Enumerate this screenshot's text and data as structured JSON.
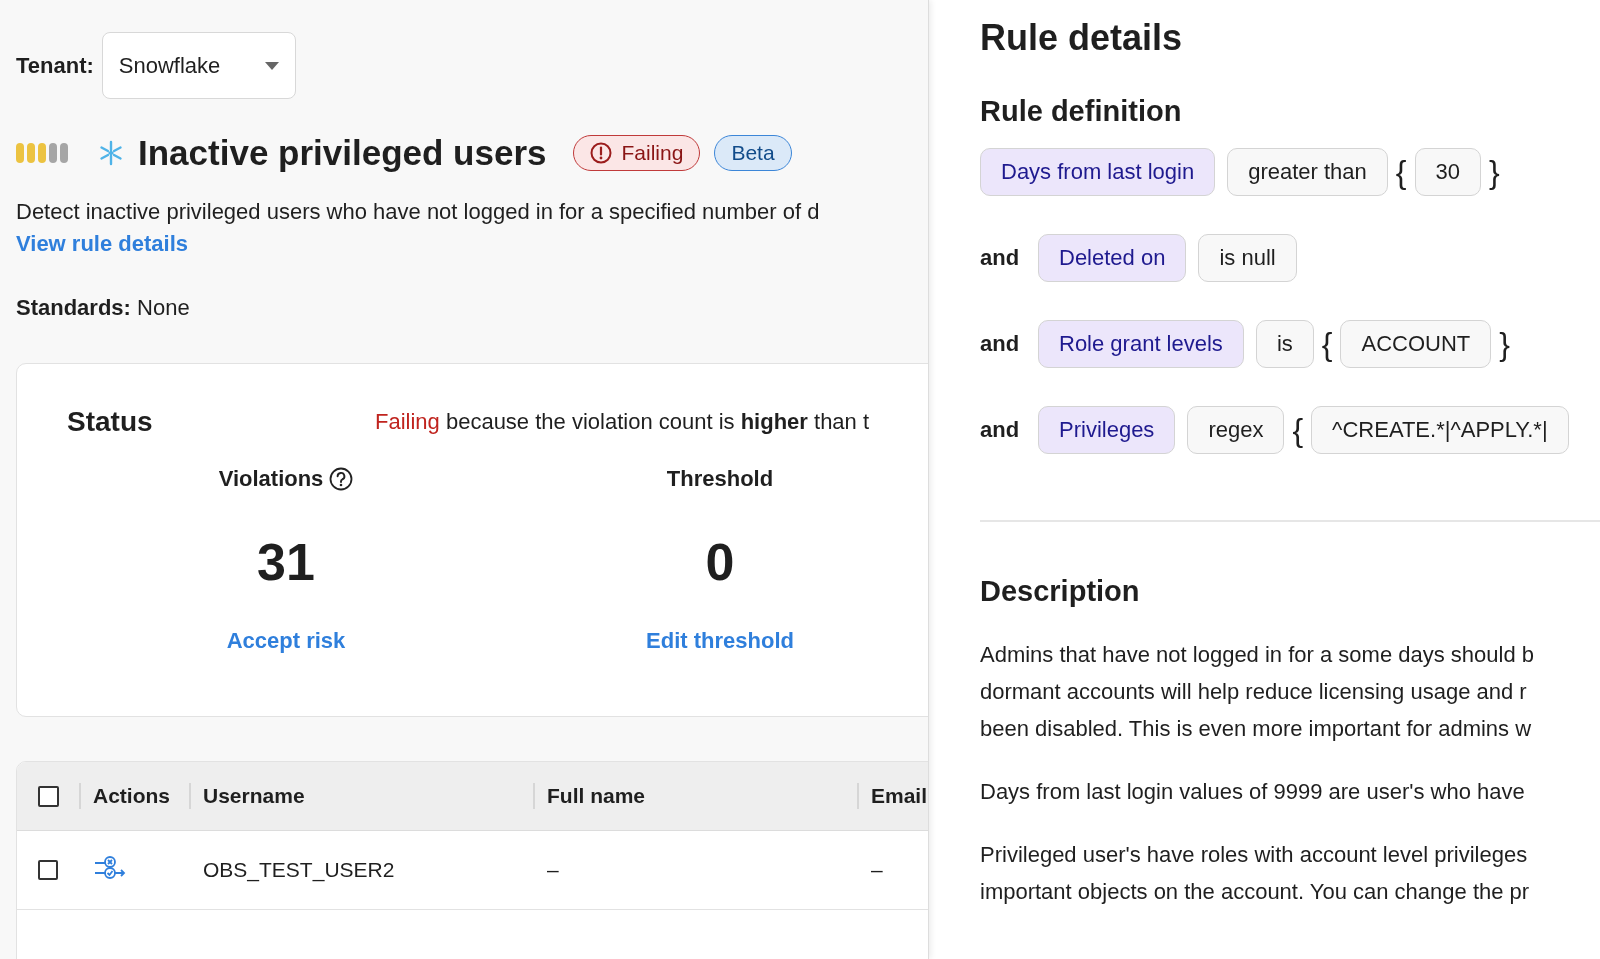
{
  "tenant": {
    "label": "Tenant:",
    "value": "Snowflake"
  },
  "rule": {
    "level": 0.6,
    "title": "Inactive privileged users",
    "badges": [
      {
        "kind": "failing",
        "label": "Failing"
      },
      {
        "kind": "beta",
        "label": "Beta"
      }
    ],
    "description": "Detect inactive privileged users who have not logged in for a specified number of d",
    "link": "View rule details",
    "standards_label": "Standards:",
    "standards_value": "None"
  },
  "status": {
    "title": "Status",
    "state": "Failing",
    "message": "because the violation count is **higher** than t",
    "metrics": [
      {
        "label": "Violations",
        "help": true,
        "value": "31",
        "action": "Accept risk"
      },
      {
        "label": "Threshold",
        "help": false,
        "value": "0",
        "action": "Edit threshold"
      }
    ]
  },
  "table": {
    "header_checked": false,
    "columns": [
      "Actions",
      "Username",
      "Full name",
      "Email"
    ],
    "rows": [
      {
        "checked": false,
        "username": "OBS_TEST_USER2",
        "full_name": "–",
        "email": "–"
      }
    ]
  },
  "rule_details": {
    "title": "Rule details",
    "definition_title": "Rule definition",
    "conditions": [
      {
        "field": "Days from last login",
        "operator": "greater than",
        "open": "{",
        "values": [
          "30"
        ],
        "close": "}"
      },
      {
        "joiner": "and",
        "field": "Deleted on",
        "operator": "is null"
      },
      {
        "joiner": "and",
        "field": "Role grant levels",
        "operator": "is",
        "open": "{",
        "values": [
          "ACCOUNT"
        ],
        "close": "}"
      },
      {
        "joiner": "and",
        "field": "Privileges",
        "operator": "regex",
        "open": "{",
        "values": [
          "^CREATE.*|^APPLY.*|"
        ]
      }
    ],
    "description_title": "Description",
    "paragraphs": [
      [
        "Admins that have not logged in for a some days should b",
        "dormant accounts will help reduce licensing usage and r",
        "been disabled. This is even more important for admins w"
      ],
      [
        "Days from last login values of 9999 are user's who have"
      ],
      [
        "Privileged user's have roles with account level privileges",
        "important objects on the account. You can change the pr"
      ]
    ]
  }
}
